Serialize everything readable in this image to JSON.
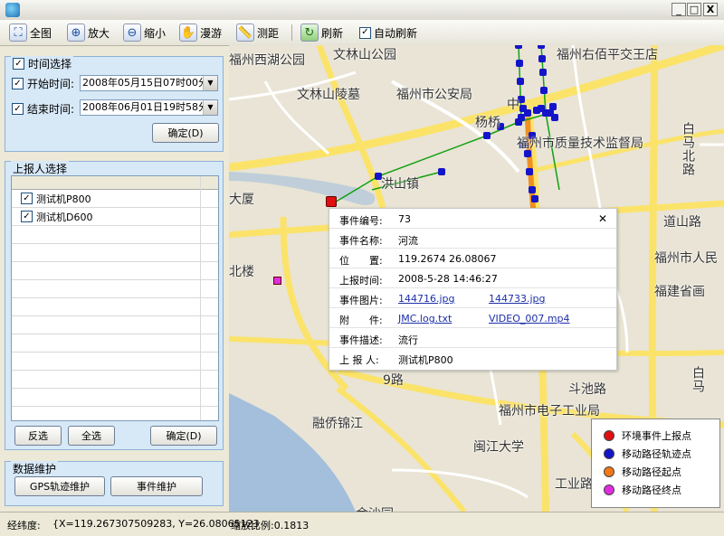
{
  "window": {
    "title": "",
    "min_label": "_",
    "max_label": "□",
    "close_label": "X"
  },
  "toolbar": {
    "full_label": "全图",
    "zoom_in_label": "放大",
    "zoom_out_label": "缩小",
    "pan_label": "漫游",
    "measure_label": "测距",
    "refresh_label": "刷新",
    "auto_refresh_label": "自动刷新",
    "auto_refresh_checked": "✓"
  },
  "time_panel": {
    "title": "时间选择",
    "start_label": "开始时间:",
    "start_value": "2008年05月15日07时00分",
    "end_label": "结束时间:",
    "end_value": "2008年06月01日19时58分",
    "ok_label": "确定(D)",
    "check": "✓"
  },
  "reporter_panel": {
    "title": "上报人选择",
    "items": [
      {
        "label": "测试机P800",
        "checked": "✓"
      },
      {
        "label": "测试机D600",
        "checked": "✓"
      }
    ],
    "invert_label": "反选",
    "all_label": "全选",
    "ok_label": "确定(D)"
  },
  "maint_panel": {
    "title": "数据维护",
    "gps_label": "GPS轨迹维护",
    "event_label": "事件维护"
  },
  "map": {
    "labels": [
      "福州西湖公园",
      "文林山公园",
      "文林山陵墓",
      "福州市公安局",
      "中",
      "杨桥",
      "福州市质量技术监督局",
      "洪山镇",
      "福州右佰平交王店",
      "白马北路",
      "道山路",
      "福州市人民",
      "福建省画",
      "大厦",
      "北楼",
      "斗池路",
      "白马",
      "福州市电子工业局",
      "融侨锦江",
      "闽江大学",
      "工业路",
      "金沙园",
      "9路"
    ]
  },
  "popup": {
    "close": "✕",
    "rows": [
      {
        "k": "事件编号:",
        "v": "73"
      },
      {
        "k": "事件名称:",
        "v": "河流"
      },
      {
        "k": "位　　置:",
        "v": "119.2674 26.08067"
      },
      {
        "k": "上报时间:",
        "v": "2008-5-28 14:46:27"
      },
      {
        "k": "事件图片:",
        "v": "144716.jpg",
        "v2": "144733.jpg"
      },
      {
        "k": "附　　件:",
        "v": "JMC.log.txt",
        "v2": "VIDEO_007.mp4"
      },
      {
        "k": "事件描述:",
        "v": "流行"
      },
      {
        "k": "上 报 人:",
        "v": "测试机P800"
      }
    ]
  },
  "legend": {
    "items": [
      {
        "label": "环境事件上报点",
        "color": "#e01010"
      },
      {
        "label": "移动路径轨迹点",
        "color": "#1414c8"
      },
      {
        "label": "移动路径起点",
        "color": "#f07818"
      },
      {
        "label": "移动路径终点",
        "color": "#e02ce0"
      }
    ]
  },
  "status": {
    "coord_label": "经纬度:",
    "coord_value": "{X=119.267307509283, Y=26.08065123",
    "scale_label": "缩放比例:0.1813"
  },
  "colors": {
    "panel_bg": "#d7e8f7",
    "road": "#fbe36a",
    "water": "#a3bfdc",
    "track": "#1414c8",
    "track_line": "#12a012"
  }
}
